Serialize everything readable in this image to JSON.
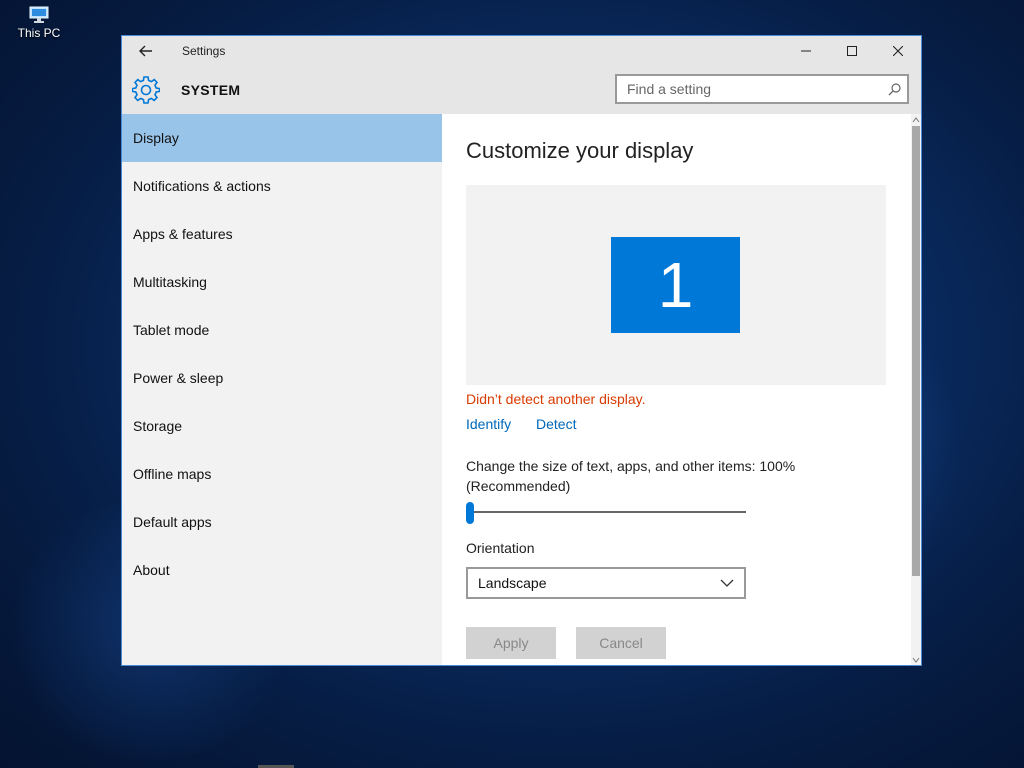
{
  "desktop": {
    "icons": [
      {
        "label": "This PC",
        "icon": "computer-icon"
      }
    ]
  },
  "window": {
    "title": "Settings",
    "back_icon": "back-arrow-icon",
    "controls": {
      "minimize_icon": "minimize-icon",
      "maximize_icon": "maximize-icon",
      "close_icon": "close-icon"
    }
  },
  "header": {
    "section_title": "SYSTEM",
    "section_icon": "gear-icon",
    "search": {
      "placeholder": "Find a setting",
      "value": "",
      "icon": "search-icon"
    }
  },
  "sidebar": {
    "items": [
      {
        "label": "Display",
        "active": true
      },
      {
        "label": "Notifications & actions"
      },
      {
        "label": "Apps & features"
      },
      {
        "label": "Multitasking"
      },
      {
        "label": "Tablet mode"
      },
      {
        "label": "Power & sleep"
      },
      {
        "label": "Storage"
      },
      {
        "label": "Offline maps"
      },
      {
        "label": "Default apps"
      },
      {
        "label": "About"
      }
    ]
  },
  "main": {
    "title": "Customize your display",
    "monitor_number": "1",
    "warning": "Didn’t detect another display.",
    "links": {
      "identify": "Identify",
      "detect": "Detect"
    },
    "scale": {
      "label": "Change the size of text, apps, and other items: 100% (Recommended)",
      "value_fraction": 0.0
    },
    "orientation": {
      "label": "Orientation",
      "selected": "Landscape"
    },
    "buttons": {
      "apply": "Apply",
      "cancel": "Cancel"
    }
  },
  "colors": {
    "accent": "#0078d7",
    "selected_nav": "#99c4ea",
    "warning_text": "#d83b01",
    "link": "#0067b8"
  }
}
